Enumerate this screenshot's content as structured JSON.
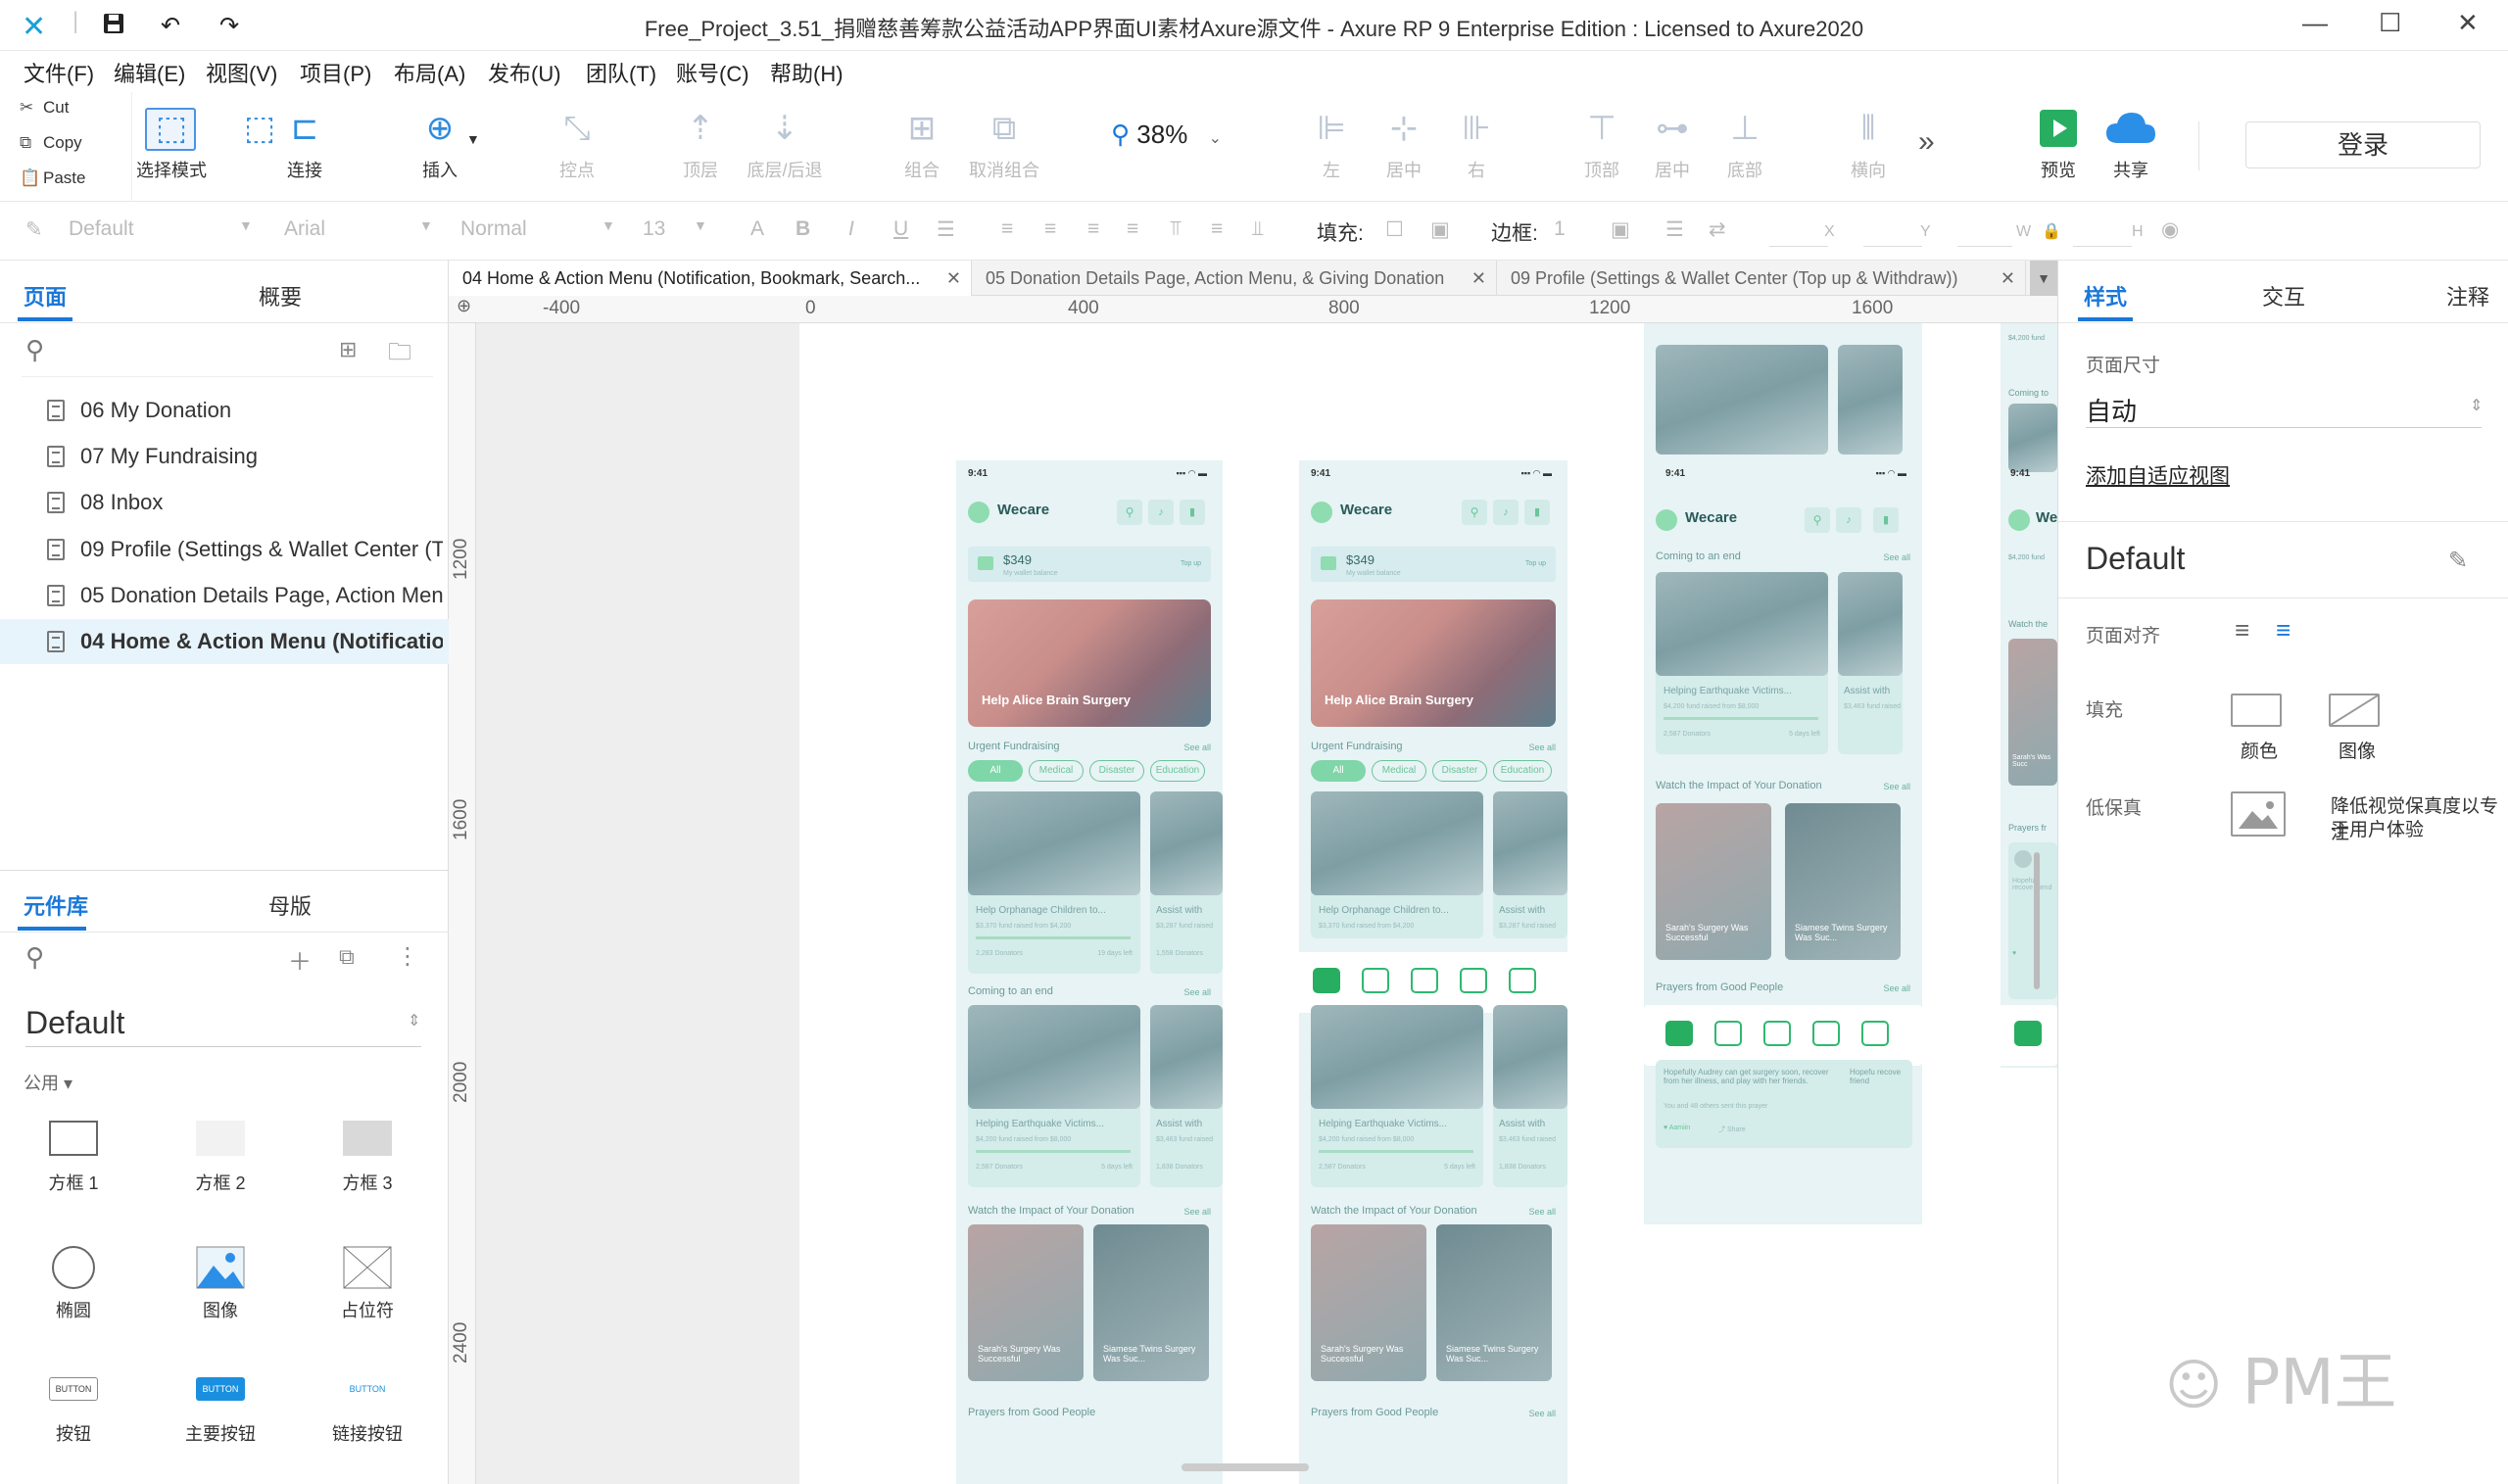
{
  "window": {
    "title": "Free_Project_3.51_捐赠慈善筹款公益活动APP界面UI素材Axure源文件 - Axure RP 9 Enterprise Edition : Licensed to Axure2020"
  },
  "menu": [
    "文件(F)",
    "编辑(E)",
    "视图(V)",
    "项目(P)",
    "布局(A)",
    "发布(U)",
    "团队(T)",
    "账号(C)",
    "帮助(H)"
  ],
  "clipboard": {
    "cut": "Cut",
    "copy": "Copy",
    "paste": "Paste"
  },
  "toolbar": {
    "select_mode": "选择模式",
    "connect": "连接",
    "insert": "插入",
    "point": "控点",
    "top_layer": "顶层",
    "bottom_layer": "底层/后退",
    "group": "组合",
    "ungroup": "取消组合",
    "zoom": "38%",
    "align_left": "左",
    "align_center": "居中",
    "align_right": "右",
    "align_top": "顶部",
    "align_middle": "居中",
    "align_bottom": "底部",
    "distribute_h": "横向",
    "preview": "预览",
    "share": "共享",
    "login": "登录"
  },
  "format": {
    "style": "Default",
    "font": "Arial",
    "weight": "Normal",
    "size": "13",
    "fill_label": "填充:",
    "border_label": "边框:",
    "border_value": "1",
    "x_label": "X",
    "y_label": "Y",
    "w_label": "W",
    "h_label": "H"
  },
  "left_panel": {
    "tab_pages": "页面",
    "tab_outline": "概要",
    "pages": [
      "06 My Donation",
      "07 My Fundraising",
      "08 Inbox",
      "09 Profile (Settings & Wallet Center (Top",
      "05 Donation Details Page, Action Menu,",
      "04 Home & Action Menu (Notification,"
    ],
    "tab_library": "元件库",
    "tab_masters": "母版",
    "library_name": "Default",
    "category": "公用 ▾",
    "components": [
      "方框 1",
      "方框 2",
      "方框 3",
      "椭圆",
      "图像",
      "占位符",
      "按钮",
      "主要按钮",
      "链接按钮"
    ],
    "button_text": "BUTTON"
  },
  "doc_tabs": [
    "04 Home & Action Menu (Notification, Bookmark, Search...",
    "05 Donation Details Page, Action Menu, & Giving Donation",
    "09 Profile (Settings & Wallet Center (Top up & Withdraw))"
  ],
  "ruler_h": [
    "-400",
    "0",
    "400",
    "800",
    "1200",
    "1600"
  ],
  "ruler_v": [
    "1200",
    "1600",
    "2000",
    "2400"
  ],
  "phones": {
    "time": "9:41",
    "brand": "Wecare",
    "balance": "$349",
    "balance_sub": "My wallet balance",
    "top_up": "Top up",
    "hero": "Help Alice Brain Surgery",
    "urgent": "Urgent Fundraising",
    "see_all": "See all",
    "chips": [
      "All",
      "Medical",
      "Disaster",
      "Education"
    ],
    "card1": "Help Orphanage Children to...",
    "card2": "Assist with",
    "card1_raised": "$3,370 fund raised from $4,200",
    "card2_raised": "$3,287 fund raised",
    "card1_meta": "2,283 Donators",
    "card1_days": "19 days left",
    "card2_meta": "1,558 Donators",
    "coming": "Coming to an end",
    "card3": "Helping Earthquake Victims...",
    "card3_raised": "$4,200 fund raised from $8,000",
    "card4_raised": "$3,463 fund raised",
    "card3_meta": "2,587 Donators",
    "card3_days": "5 days left",
    "card4_meta": "1,838 Donators",
    "impact": "Watch the Impact of Your Donation",
    "vid1": "Sarah's Surgery Was Successful",
    "vid2": "Siamese Twins Surgery Was Suc...",
    "prayers": "Prayers from Good People",
    "prayer_text": "Hopefully Audrey can get surgery soon, recover from her illness, and play with her friends.",
    "prayer_sub": "You and 48 others sent this prayer",
    "aamiin": "Aamiin",
    "share": "Share",
    "partial_brand": "We",
    "partial_raised": "$4,200 fund",
    "partial_coming": "Coming to",
    "partial_watch": "Watch the",
    "partial_prayers": "Prayers fr",
    "partial_prayer_text": "Hopefu recove friend",
    "partial_vid": "Sarah's Was Succ"
  },
  "right_panel": {
    "tab_style": "样式",
    "tab_interact": "交互",
    "tab_notes": "注释",
    "page_size_label": "页面尺寸",
    "page_size_value": "自动",
    "add_adaptive": "添加自适应视图",
    "style_name": "Default",
    "page_align_label": "页面对齐",
    "fill_label": "填充",
    "fill_color": "颜色",
    "fill_image": "图像",
    "lowfi_label": "低保真",
    "lowfi_text_1": "降低视觉保真度以专注",
    "lowfi_text_2": "于用户体验"
  },
  "watermark": "PM王",
  "colors": {
    "accent_blue": "#1a78d8",
    "brand_green": "#27ae60",
    "canvas_bg": "#eeeeee",
    "share_blue": "#2b8fe8"
  }
}
